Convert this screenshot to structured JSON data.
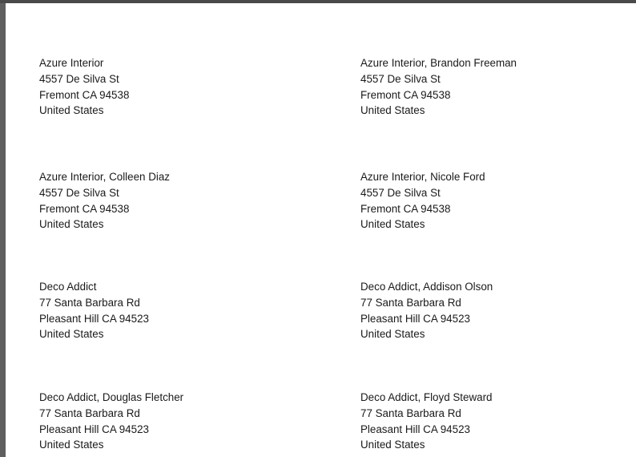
{
  "labels": [
    {
      "name": "Azure Interior",
      "street": "4557 De Silva St",
      "city": "Fremont CA 94538",
      "country": "United States"
    },
    {
      "name": "Azure Interior, Brandon Freeman",
      "street": "4557 De Silva St",
      "city": "Fremont CA 94538",
      "country": "United States"
    },
    {
      "name": "Azure Interior, Colleen Diaz",
      "street": "4557 De Silva St",
      "city": "Fremont CA 94538",
      "country": "United States"
    },
    {
      "name": "Azure Interior, Nicole Ford",
      "street": "4557 De Silva St",
      "city": "Fremont CA 94538",
      "country": "United States"
    },
    {
      "name": "Deco Addict",
      "street": "77 Santa Barbara Rd",
      "city": "Pleasant Hill CA 94523",
      "country": "United States"
    },
    {
      "name": "Deco Addict, Addison Olson",
      "street": "77 Santa Barbara Rd",
      "city": "Pleasant Hill CA 94523",
      "country": "United States"
    },
    {
      "name": "Deco Addict, Douglas Fletcher",
      "street": "77 Santa Barbara Rd",
      "city": "Pleasant Hill CA 94523",
      "country": "United States"
    },
    {
      "name": "Deco Addict, Floyd Steward",
      "street": "77 Santa Barbara Rd",
      "city": "Pleasant Hill CA 94523",
      "country": "United States"
    }
  ]
}
